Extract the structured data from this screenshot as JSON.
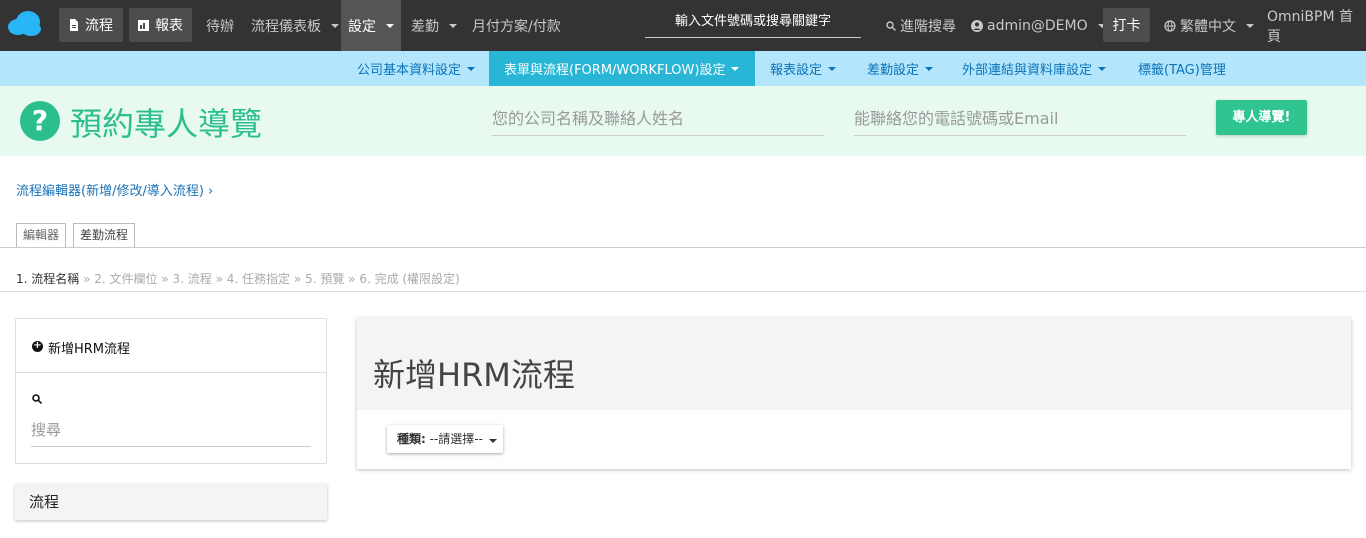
{
  "topnav": {
    "flow_btn": "流程",
    "report_btn": "報表",
    "todo": "待辦",
    "dashboard": "流程儀表板",
    "settings": "設定",
    "attendance": "差勤",
    "payment": "月付方案/付款",
    "search_placeholder": "輸入文件號碼或搜尋關鍵字",
    "advanced_search": "進階搜尋",
    "user": "admin@DEMO",
    "clock_in": "打卡",
    "language": "繁體中文",
    "home": "OmniBPM 首頁"
  },
  "subnav": {
    "items": [
      "公司基本資料設定",
      "表單與流程(FORM/WORKFLOW)設定",
      "報表設定",
      "差勤設定",
      "外部連結與資料庫設定",
      "標籤(TAG)管理"
    ]
  },
  "tour": {
    "title": "預約專人導覽",
    "company_placeholder": "您的公司名稱及聯絡人姓名",
    "contact_placeholder": "能聯絡您的電話號碼或Email",
    "button": "專人導覽!"
  },
  "breadcrumb": "流程編輯器(新增/修改/導入流程)",
  "tabs": [
    "編輯器",
    "差勤流程"
  ],
  "steps": {
    "s1": "1. 流程名稱",
    "s2": "2. 文件欄位",
    "s3": "3. 流程",
    "s4": "4. 任務指定",
    "s5": "5. 預覽",
    "s6": "6. 完成 (權限設定)",
    "sep": "»"
  },
  "left": {
    "add_label": "新增HRM流程",
    "search_placeholder": "搜尋",
    "flow_label": "流程"
  },
  "right": {
    "title": "新增HRM流程",
    "type_label": "種類:",
    "type_value": "--請選擇--"
  },
  "colors": {
    "topbar": "#333333",
    "subbar": "#b3e5fc",
    "subbar_active": "#29b6d6",
    "accent_green": "#2bbf8e",
    "link_blue": "#1a73b8"
  }
}
